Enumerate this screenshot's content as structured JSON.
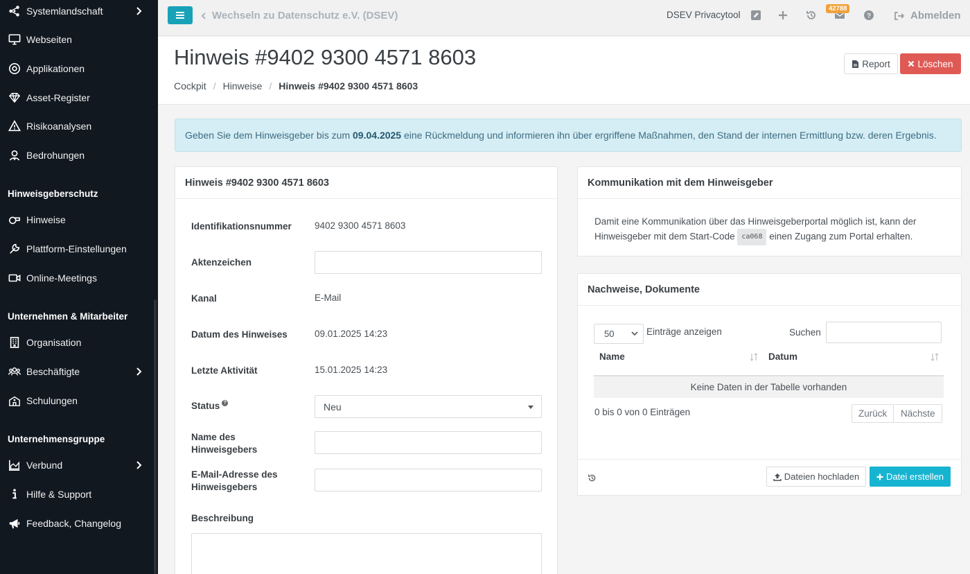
{
  "sidebar": {
    "items": [
      {
        "label": "Systemlandschaft",
        "icon": "network-icon",
        "has_submenu": true
      },
      {
        "label": "Webseiten",
        "icon": "monitor-icon",
        "has_submenu": false
      },
      {
        "label": "Applikationen",
        "icon": "target-icon",
        "has_submenu": false
      },
      {
        "label": "Asset-Register",
        "icon": "diamond-icon",
        "has_submenu": false
      },
      {
        "label": "Risikoanalysen",
        "icon": "warning-icon",
        "has_submenu": false
      },
      {
        "label": "Bedrohungen",
        "icon": "user-secret-icon",
        "has_submenu": false
      }
    ],
    "section_whistle": "Hinweisgeberschutz",
    "whistle_items": [
      {
        "label": "Hinweise",
        "icon": "whistle-icon"
      },
      {
        "label": "Plattform-Einstellungen",
        "icon": "wrench-icon"
      },
      {
        "label": "Online-Meetings",
        "icon": "video-icon"
      }
    ],
    "section_company": "Unternehmen & Mitarbeiter",
    "company_items": [
      {
        "label": "Organisation",
        "icon": "building-icon"
      },
      {
        "label": "Beschäftigte",
        "icon": "users-icon",
        "has_submenu": true
      },
      {
        "label": "Schulungen",
        "icon": "school-icon"
      }
    ],
    "section_group": "Unternehmensgruppe",
    "group_items": [
      {
        "label": "Verbund",
        "icon": "chart-area-icon",
        "has_submenu": true
      },
      {
        "label": "Hilfe & Support",
        "icon": "info-icon"
      },
      {
        "label": "Feedback, Changelog",
        "icon": "megaphone-icon"
      }
    ]
  },
  "topbar": {
    "switch_label": "Wechseln zu Datenschutz e.V. (DSEV)",
    "app_name": "DSEV Privacytool",
    "badge_count": "42788",
    "logout_label": "Abmelden"
  },
  "header": {
    "title": "Hinweis #9402 9300 4571 8603",
    "breadcrumb": [
      "Cockpit",
      "Hinweise",
      "Hinweis #9402 9300 4571 8603"
    ],
    "report_label": "Report",
    "delete_label": "Löschen"
  },
  "alert": {
    "prefix": "Geben Sie dem Hinweisgeber bis zum ",
    "date": "09.04.2025",
    "suffix": " eine Rückmeldung und informieren ihn über ergriffene Maßnahmen, den Stand der internen Ermittlung bzw. deren Ergebnis."
  },
  "details": {
    "card_title": "Hinweis #9402 9300 4571 8603",
    "id_label": "Identifikationsnummer",
    "id_value": "9402 9300 4571 8603",
    "ref_label": "Aktenzeichen",
    "ref_value": "",
    "channel_label": "Kanal",
    "channel_value": "E-Mail",
    "date_label": "Datum des Hinweises",
    "date_value": "09.01.2025 14:23",
    "activity_label": "Letzte Aktivität",
    "activity_value": "15.01.2025 14:23",
    "status_label": "Status",
    "status_value": "Neu",
    "name_label_1": "Name des",
    "name_label_2": "Hinweisgebers",
    "email_label_1": "E-Mail-Adresse des",
    "email_label_2": "Hinweisgebers",
    "desc_label": "Beschreibung"
  },
  "communication": {
    "card_title": "Kommunikation mit dem Hinweisgeber",
    "text_1": "Damit eine Kommunikation über das Hinweisgeberportal möglich ist, kann der",
    "text_2a": "Hinweisgeber mit dem Start-Code",
    "code": "ca068",
    "text_2b": "einen Zugang zum Portal erhalten."
  },
  "documents": {
    "card_title": "Nachweise, Dokumente",
    "page_size": "50",
    "entries_label": "Einträge anzeigen",
    "search_label": "Suchen",
    "columns": [
      "Name",
      "Datum"
    ],
    "empty_text": "Keine Daten in der Tabelle vorhanden",
    "info_text": "0 bis 0 von 0 Einträgen",
    "prev_label": "Zurück",
    "next_label": "Nächste",
    "upload_label": "Dateien hochladen",
    "create_label": "Datei erstellen"
  },
  "colors": {
    "sidebar_bg": "#111820",
    "accent": "#17a2b8",
    "danger": "#e05a55",
    "badge": "#f0a23a"
  }
}
